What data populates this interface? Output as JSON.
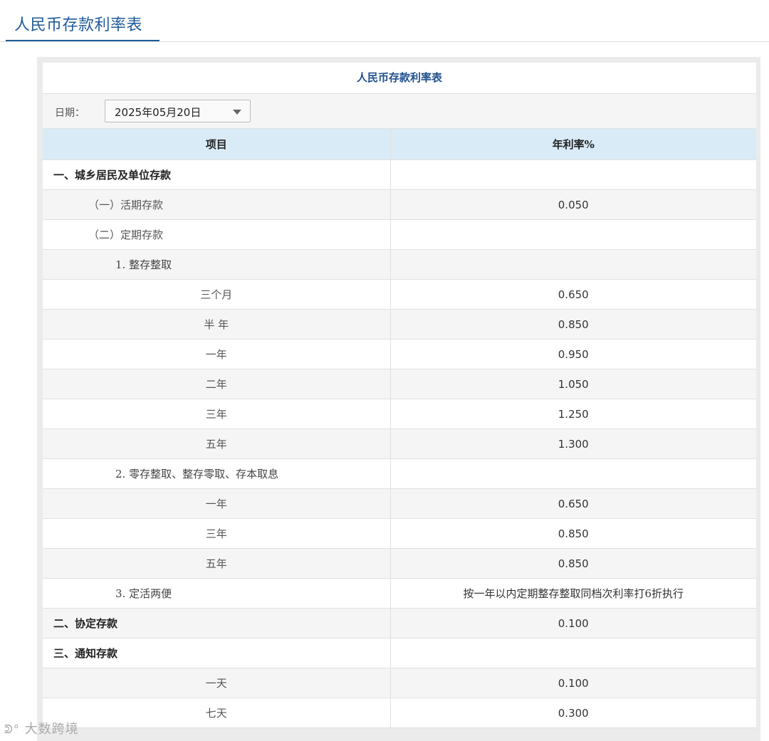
{
  "header": {
    "title": "人民币存款利率表"
  },
  "table": {
    "caption": "人民币存款利率表",
    "date_label": "日期：",
    "date_value": "2025年05月20日",
    "columns": [
      "项目",
      "年利率%"
    ],
    "rows": [
      {
        "item": "一、城乡居民及单位存款",
        "level": 0,
        "rate": ""
      },
      {
        "item": "（一）活期存款",
        "level": 1,
        "rate": "0.050"
      },
      {
        "item": "（二）定期存款",
        "level": 1,
        "rate": ""
      },
      {
        "item": "1. 整存整取",
        "level": 2,
        "rate": ""
      },
      {
        "item": "三个月",
        "level": 3,
        "rate": "0.650"
      },
      {
        "item": "半 年",
        "level": 3,
        "rate": "0.850"
      },
      {
        "item": "一年",
        "level": 3,
        "rate": "0.950"
      },
      {
        "item": "二年",
        "level": 3,
        "rate": "1.050"
      },
      {
        "item": "三年",
        "level": 3,
        "rate": "1.250"
      },
      {
        "item": "五年",
        "level": 3,
        "rate": "1.300"
      },
      {
        "item": "2. 零存整取、整存零取、存本取息",
        "level": 2,
        "rate": ""
      },
      {
        "item": "一年",
        "level": 3,
        "rate": "0.650"
      },
      {
        "item": "三年",
        "level": 3,
        "rate": "0.850"
      },
      {
        "item": "五年",
        "level": 3,
        "rate": "0.850"
      },
      {
        "item": "3. 定活两便",
        "level": 2,
        "rate": "按一年以内定期整存整取同档次利率打6折执行"
      },
      {
        "item": "二、协定存款",
        "level": 0,
        "rate": "0.100"
      },
      {
        "item": "三、通知存款",
        "level": 0,
        "rate": ""
      },
      {
        "item": "一天",
        "level": 3,
        "rate": "0.100"
      },
      {
        "item": "七天",
        "level": 3,
        "rate": "0.300"
      }
    ]
  },
  "watermark": {
    "icon": "weibo-logo-icon",
    "text": "大数跨境"
  }
}
